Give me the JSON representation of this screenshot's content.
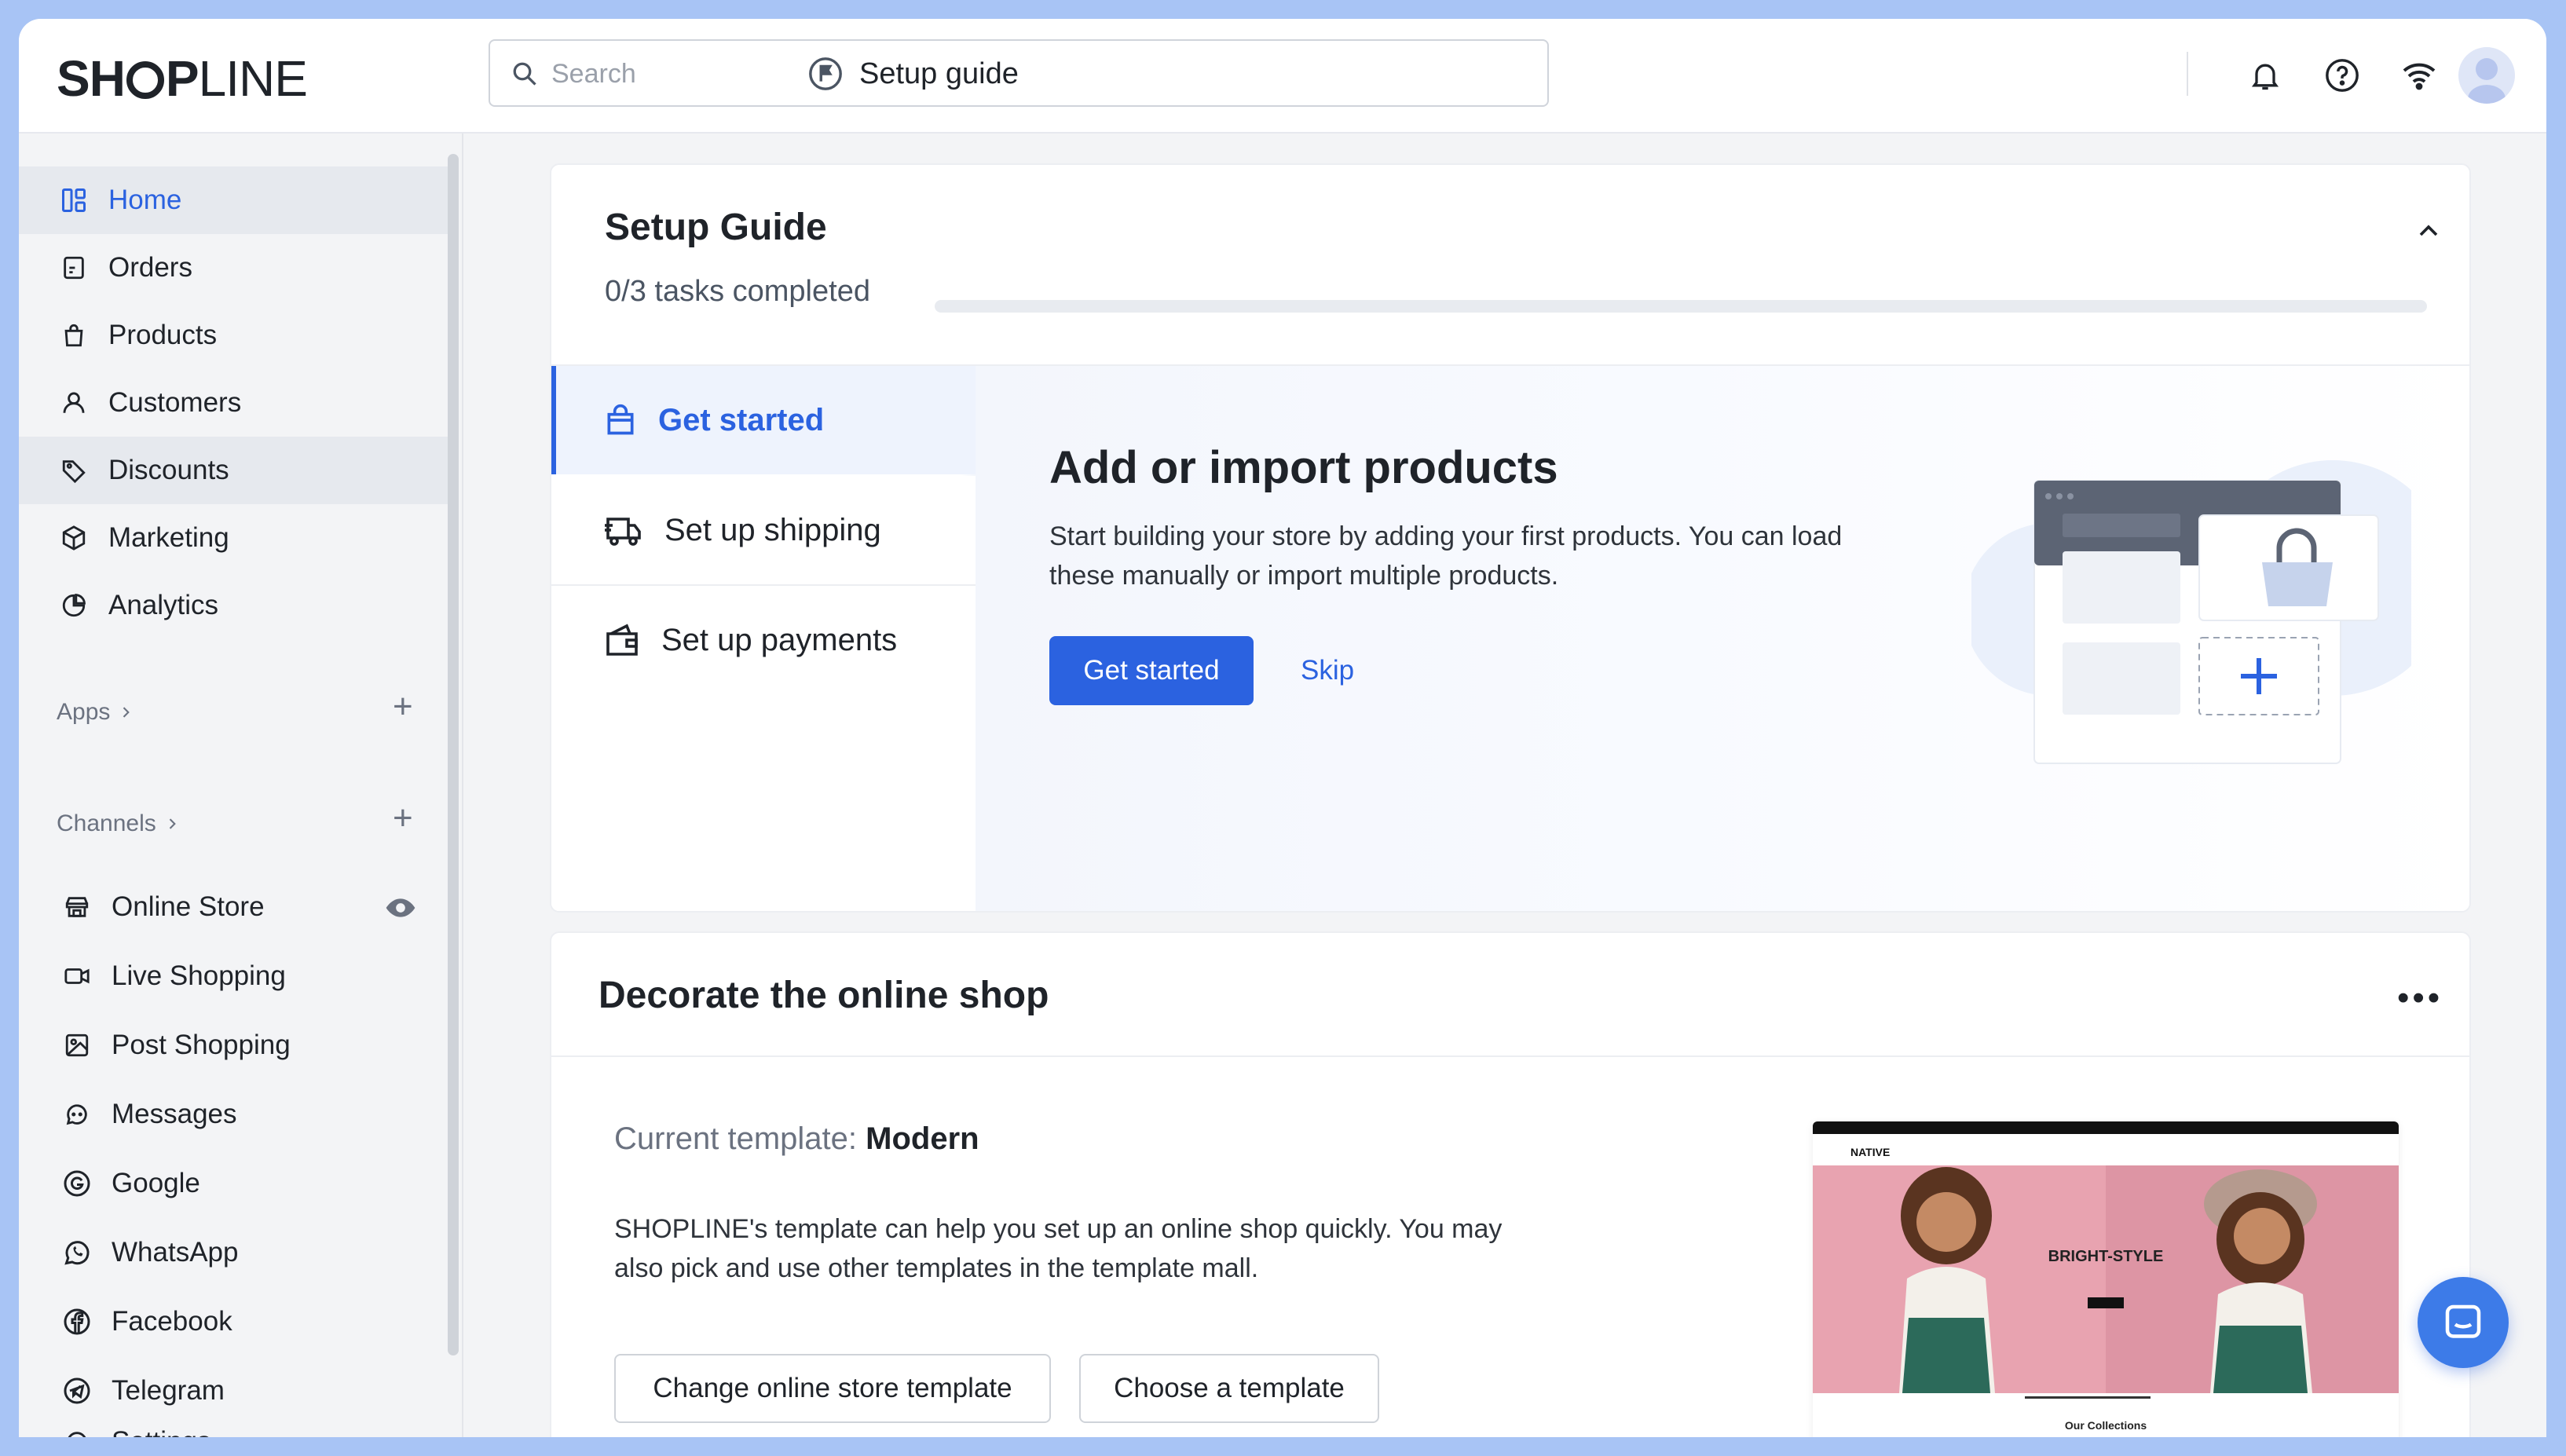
{
  "brand": {
    "logo_left": "SH",
    "logo_right": "P",
    "logo_light": "LINE"
  },
  "topbar": {
    "search_placeholder": "Search",
    "setup_guide": "Setup guide"
  },
  "sidebar": {
    "items": [
      {
        "label": "Home",
        "icon": "home-icon"
      },
      {
        "label": "Orders",
        "icon": "orders-icon"
      },
      {
        "label": "Products",
        "icon": "bag-icon"
      },
      {
        "label": "Customers",
        "icon": "user-icon"
      },
      {
        "label": "Discounts",
        "icon": "tag-icon"
      },
      {
        "label": "Marketing",
        "icon": "cube-icon"
      },
      {
        "label": "Analytics",
        "icon": "pie-chart-icon"
      }
    ],
    "apps_label": "Apps",
    "channels_label": "Channels",
    "channels": [
      {
        "label": "Online Store",
        "icon": "store-icon"
      },
      {
        "label": "Live Shopping",
        "icon": "video-icon"
      },
      {
        "label": "Post Shopping",
        "icon": "image-icon"
      },
      {
        "label": "Messages",
        "icon": "chat-icon"
      },
      {
        "label": "Google",
        "icon": "google-icon"
      },
      {
        "label": "WhatsApp",
        "icon": "whatsapp-icon"
      },
      {
        "label": "Facebook",
        "icon": "facebook-icon"
      },
      {
        "label": "Telegram",
        "icon": "telegram-icon"
      },
      {
        "label": "Settings",
        "icon": "settings-icon"
      }
    ]
  },
  "setup_guide": {
    "title": "Setup Guide",
    "progress_text": "0/3 tasks completed",
    "progress_fraction": 0,
    "steps": [
      {
        "label": "Get started",
        "icon": "shopping-bag-icon"
      },
      {
        "label": "Set up shipping",
        "icon": "truck-icon"
      },
      {
        "label": "Set up payments",
        "icon": "wallet-icon"
      }
    ],
    "panel": {
      "title": "Add or import products",
      "description": "Start building your store by adding your first products. You can load these manually or import multiple products.",
      "primary_button": "Get started",
      "secondary_button": "Skip"
    }
  },
  "decorate": {
    "title": "Decorate the online shop",
    "current_template_label": "Current template:",
    "current_template_value": "Modern",
    "description": "SHOPLINE's template can help you set up an online shop quickly. You may also pick and use other templates in the template mall.",
    "change_button": "Change online store template",
    "choose_button": "Choose a template",
    "preview": {
      "brand": "NATIVE",
      "headline": "BRIGHT-STYLE",
      "collections": "Our Collections"
    }
  },
  "colors": {
    "accent": "#2b62e0",
    "frame": "#a8c4f5"
  }
}
